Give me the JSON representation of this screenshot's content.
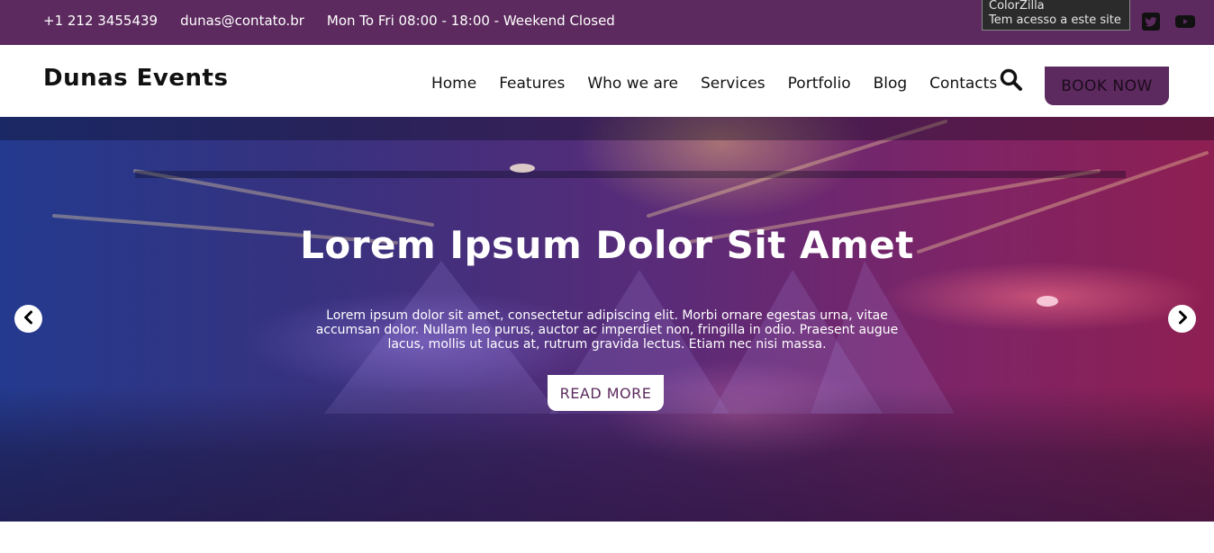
{
  "topbar": {
    "phone": "+1 212 3455439",
    "email": "dunas@contato.br",
    "hours": "Mon To Fri 08:00 - 18:00 - Weekend Closed",
    "social": [
      "facebook-icon",
      "twitter-icon",
      "youtube-icon"
    ]
  },
  "tooltip": {
    "line1": "ColorZilla",
    "line2": "Tem acesso a este site"
  },
  "header": {
    "logo": "Dunas Events",
    "nav": [
      "Home",
      "Features",
      "Who we are",
      "Services",
      "Portfolio",
      "Blog",
      "Contacts"
    ],
    "book_label": "BOOK NOW"
  },
  "hero": {
    "title": "Lorem Ipsum Dolor Sit Amet",
    "text": "Lorem ipsum dolor sit amet, consectetur adipiscing elit. Morbi ornare egestas urna, vitae accumsan dolor. Nullam leo purus, auctor ac imperdiet non, fringilla in odio. Praesent augue lacus, mollis ut lacus at, rutrum gravida lectus. Etiam nec nisi massa.",
    "button_label": "READ MORE"
  },
  "colors": {
    "brand": "#5c2a5e",
    "hero_left": "#243a8e",
    "hero_right": "#8e1f52"
  }
}
